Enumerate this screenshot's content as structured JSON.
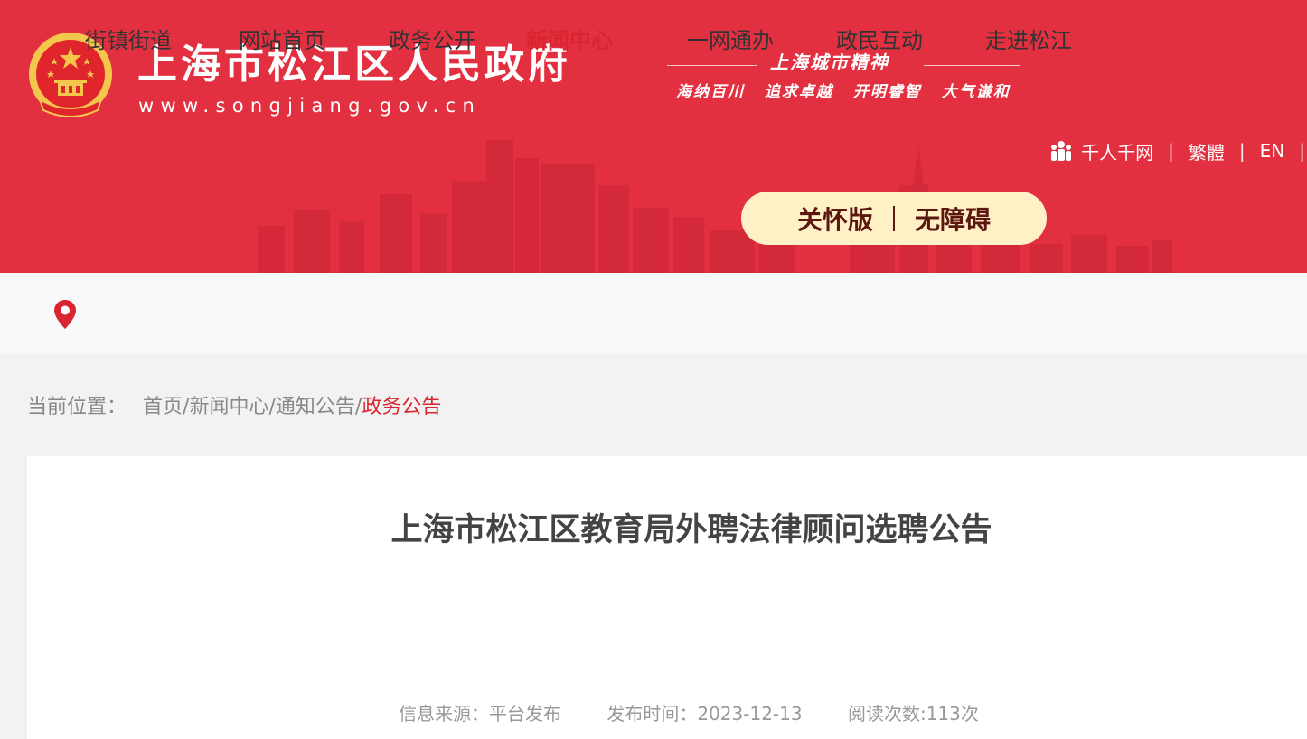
{
  "header": {
    "title": "上海市松江区人民政府",
    "url": "www.songjiang.gov.cn",
    "spirit_title": "上海城市精神",
    "spirit_items": [
      "海纳百川",
      "追求卓越",
      "开明睿智",
      "大气谦和"
    ],
    "links": {
      "qianren": "千人千网",
      "traditional": "繁體",
      "english": "EN"
    },
    "care_version": "关怀版",
    "accessibility": "无障碍",
    "colors": {
      "banner": "#e33040",
      "pill": "#fff0c6",
      "accent": "#d9252f"
    }
  },
  "nav": {
    "streets": "街镇街道",
    "items": [
      "网站首页",
      "政务公开",
      "新闻中心",
      "一网通办",
      "政民互动",
      "走进松江"
    ],
    "active": "新闻中心"
  },
  "breadcrumb": {
    "label": "当前位置：",
    "path": [
      "首页",
      "新闻中心",
      "通知公告"
    ],
    "current": "政务公告"
  },
  "article": {
    "title": "上海市松江区教育局外聘法律顾问选聘公告",
    "source": "信息来源：平台发布",
    "date": "发布时间：2023-12-13",
    "views": "阅读次数:113次"
  },
  "icons": [
    "emblem-icon",
    "people-icon",
    "location-pin-icon"
  ]
}
